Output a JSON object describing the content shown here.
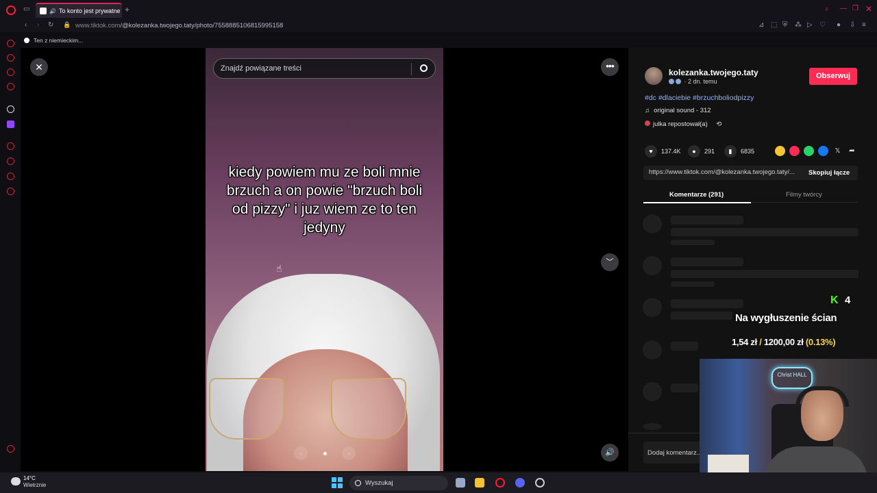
{
  "browser": {
    "tab_title": "To konto jest prywatne",
    "url_host": "www.tiktok.com",
    "url_path": "/@kolezanka.twojego.taty/photo/7558885106815995158",
    "bookmark": "Ten z niemieckim..."
  },
  "viewer": {
    "search_placeholder": "Znajdź powiązane treści",
    "caption": "kiedy powiem mu ze boli mnie brzuch a on powie \"brzuch boli od pizzy\" i juz wiem ze to ten jedyny"
  },
  "post": {
    "username": "kolezanka.twojego.taty",
    "time_ago": "· 2 dn. temu",
    "follow_label": "Obserwuj",
    "hashtags": "#dc #dlaciebie #brzuchboliodpizzy",
    "sound": "original sound - 312",
    "repost": "julka repostował(a)",
    "likes": "137.4K",
    "comments": "291",
    "saves": "6835",
    "link": "https://www.tiktok.com/@kolezanka.twojego.taty/...",
    "copy_label": "Skopiuj łącze",
    "tab_comments": "Komentarze (291)",
    "tab_creator": "Filmy twórcy",
    "add_comment": "Dodaj komentarz..."
  },
  "overlay": {
    "count": "4",
    "title": "Na wygłuszenie ścian",
    "raised": "1,54 zł",
    "goal": "1200,00 zł",
    "percent": "(0.13%)",
    "neon_sign": "Christ HALL"
  },
  "taskbar": {
    "temp": "14°C",
    "weather": "Wietrznie",
    "search": "Wyszukaj"
  },
  "colors": {
    "accent": "#fe2c55",
    "hashtag": "#8fb4ff",
    "kick_green": "#53fc18",
    "overlay_yellow": "#f7d44c"
  }
}
